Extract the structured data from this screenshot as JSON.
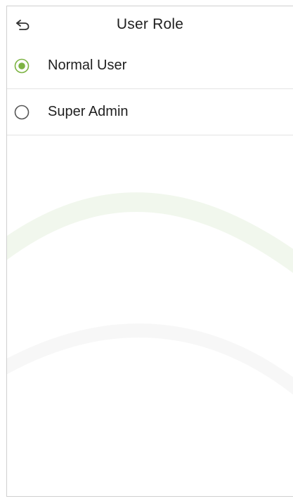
{
  "header": {
    "title": "User Role",
    "back_icon": "back-arrow-icon"
  },
  "options": [
    {
      "label": "Normal User",
      "selected": true
    },
    {
      "label": "Super Admin",
      "selected": false
    }
  ],
  "colors": {
    "accent": "#7cb342",
    "text": "#1f1f1f",
    "divider": "#e4e4e4",
    "radio_border": "#555555"
  }
}
